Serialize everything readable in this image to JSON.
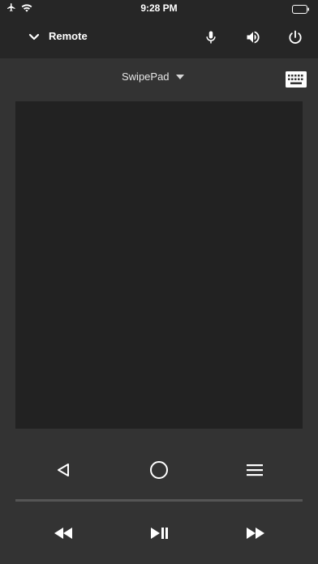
{
  "status_bar": {
    "time": "9:28 PM",
    "icons": [
      "airplane-icon",
      "wifi-icon",
      "battery-icon"
    ]
  },
  "header": {
    "title": "Remote",
    "icons": [
      "chevron-down-icon",
      "microphone-icon",
      "volume-icon",
      "power-icon"
    ]
  },
  "mode": {
    "label": "SwipePad",
    "icons": [
      "dropdown-arrow-icon",
      "keyboard-icon"
    ]
  },
  "navigation": {
    "icons": [
      "back-icon",
      "home-icon",
      "menu-icon"
    ]
  },
  "media": {
    "icons": [
      "rewind-icon",
      "play-pause-icon",
      "fast-forward-icon"
    ]
  },
  "colors": {
    "background": "#333333",
    "header": "#262626",
    "pad": "#222222",
    "divider": "#555555",
    "icon": "#ffffff"
  }
}
